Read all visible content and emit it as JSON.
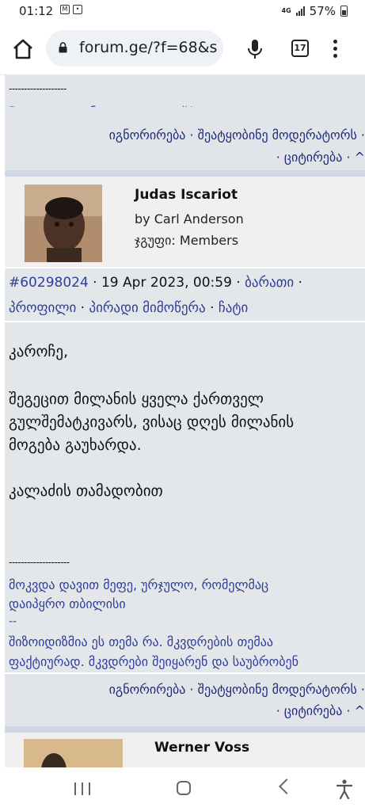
{
  "status": {
    "time": "01:12",
    "net": "4G",
    "battery": "57%"
  },
  "browser": {
    "url": "forum.ge/?f=68&s",
    "tab_count": "17"
  },
  "prev_post": {
    "sig_sep": "-------------------",
    "sig_line": "Русски корабль, иди нахуй!",
    "actions_line1": "იგნორირება · შეატყობინე მოდერატორს ·",
    "actions_line2": "· ციტირება · ^"
  },
  "post": {
    "username": "Judas Iscariot",
    "subtitle": "by Carl Anderson",
    "group": "ჯგუფი: Members",
    "post_id": "#60298024",
    "datetime": " · 19 Apr 2023, 00:59 · ",
    "link_share": "ბარათი",
    "link_profile": "პროფილი",
    "link_pm": "პირადი მიმოწერა",
    "link_chat": "ჩატი",
    "body_line1": "კაროჩე,",
    "body_line2": "შეგეცით მილანის ყველა ქართველ",
    "body_line3": "გულშემატკივარს, ვისაც დღეს მილანის",
    "body_line4": "მოგება გაუხარდა.",
    "body_line5": "კალაძის თამადობით",
    "sig_sep": "--------------------",
    "sig1": "მოკვდა დავით მეფე, ურჯულო, რომელმაც",
    "sig2": "დაიპყრო თბილისი",
    "sig3": "--",
    "sig4": "შიზოიდიზმია ეს თემა რა. მკვდრების თემაა",
    "sig5": "ფაქტიურად. მკვდრები შეიყარენ და საუბრობენ",
    "actions_line1": "იგნორირება · შეატყობინე მოდერატორს ·",
    "actions_line2": "· ციტირება · ^"
  },
  "next_post": {
    "username": "Werner Voss"
  }
}
